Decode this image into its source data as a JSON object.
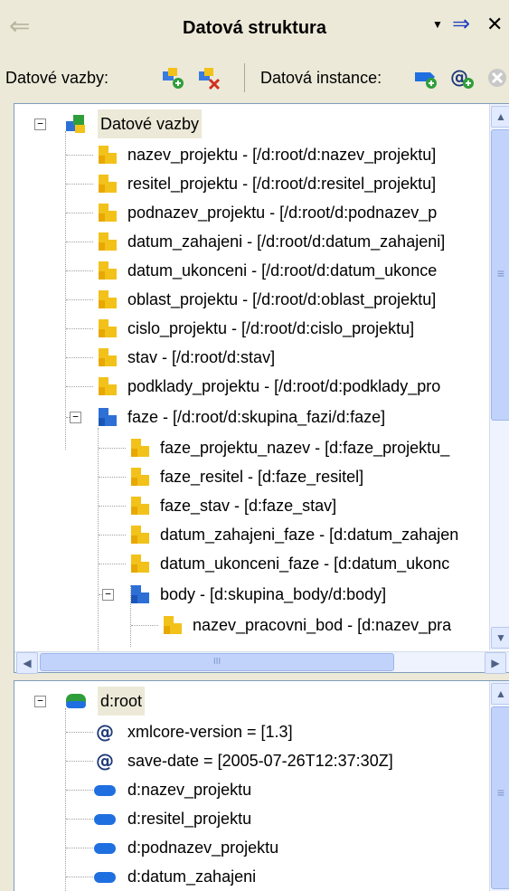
{
  "title": "Datová struktura",
  "toolbar": {
    "bindings_label": "Datové vazby:",
    "instance_label": "Datová instance:"
  },
  "bindings_tree": {
    "root_label": "Datové vazby",
    "items": [
      "nazev_projektu - [/d:root/d:nazev_projektu]",
      "resitel_projektu - [/d:root/d:resitel_projektu]",
      "podnazev_projektu - [/d:root/d:podnazev_p",
      "datum_zahajeni - [/d:root/d:datum_zahajeni]",
      "datum_ukonceni - [/d:root/d:datum_ukonce",
      "oblast_projektu - [/d:root/d:oblast_projektu]",
      "cislo_projektu - [/d:root/d:cislo_projektu]",
      "stav - [/d:root/d:stav]",
      "podklady_projektu - [/d:root/d:podklady_pro",
      "faze - [/d:root/d:skupina_fazi/d:faze]",
      "faze_projektu_nazev - [d:faze_projektu_",
      "faze_resitel - [d:faze_resitel]",
      "faze_stav - [d:faze_stav]",
      "datum_zahajeni_faze - [d:datum_zahajen",
      "datum_ukonceni_faze - [d:datum_ukonc",
      "body - [d:skupina_body/d:body]",
      "nazev_pracovni_bod - [d:nazev_pra"
    ]
  },
  "instance_tree": {
    "root_label": "d:root",
    "items": [
      "xmlcore-version = [1.3]",
      "save-date = [2005-07-26T12:37:30Z]",
      "d:nazev_projektu",
      "d:resitel_projektu",
      "d:podnazev_projektu",
      "d:datum_zahajeni"
    ]
  },
  "glyphs": {
    "back": "⇐",
    "dropdown": "▼",
    "pin": "⇒",
    "close": "✕",
    "minus": "−",
    "up": "▲",
    "down": "▼",
    "left": "◀",
    "right": "▶",
    "grip": "≡",
    "hgrip": "III",
    "attr": "@"
  },
  "colors": {
    "folder_yellow": "#f2c21b",
    "folder_blue": "#2e6fd6",
    "instance_green": "#2f9e3a",
    "element_blue": "#1f6fe0"
  }
}
